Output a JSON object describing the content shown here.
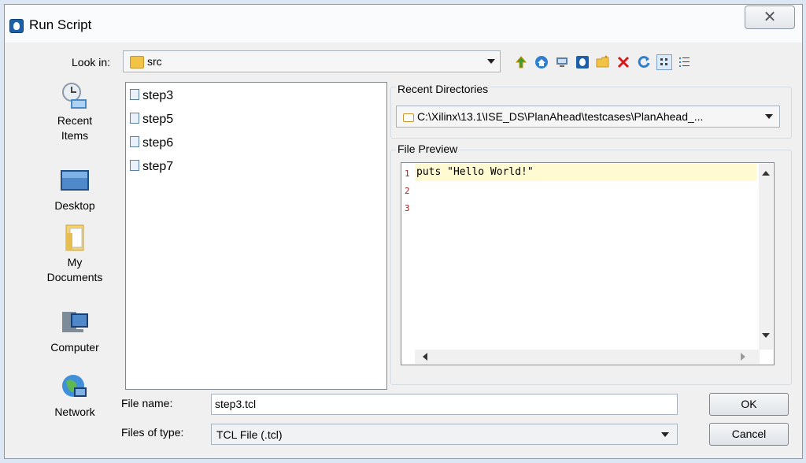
{
  "window": {
    "title": "Run Script",
    "close_glyph": "✕"
  },
  "look_in": {
    "label": "Look in:",
    "value": "src"
  },
  "toolbar": {
    "icons": [
      "up-folder-icon",
      "home-icon",
      "desktop-icon",
      "project-icon",
      "new-folder-icon",
      "delete-icon",
      "refresh-icon",
      "list-view-icon",
      "details-view-icon"
    ]
  },
  "places": [
    {
      "label_line1": "Recent",
      "label_line2": "Items",
      "icon": "recent-items-icon"
    },
    {
      "label_line1": "Desktop",
      "label_line2": "",
      "icon": "desktop-icon"
    },
    {
      "label_line1": "My",
      "label_line2": "Documents",
      "icon": "documents-icon"
    },
    {
      "label_line1": "Computer",
      "label_line2": "",
      "icon": "computer-icon"
    },
    {
      "label_line1": "Network",
      "label_line2": "",
      "icon": "network-icon"
    }
  ],
  "files": [
    "step3",
    "step5",
    "step6",
    "step7"
  ],
  "recent_directories": {
    "label": "Recent Directories",
    "value": "C:\\Xilinx\\13.1\\ISE_DS\\PlanAhead\\testcases\\PlanAhead_..."
  },
  "file_preview": {
    "label": "File Preview",
    "line_numbers": [
      "1",
      "2",
      "3"
    ],
    "code": "puts \"Hello World!\""
  },
  "file_name": {
    "label": "File name:",
    "value": "step3.tcl"
  },
  "files_of_type": {
    "label": "Files of type:",
    "value": "TCL File (.tcl)"
  },
  "buttons": {
    "ok": "OK",
    "cancel": "Cancel"
  },
  "colors": {
    "accent": "#1d5fa8",
    "preview_highlight": "#fffad2",
    "line_number": "#b01b1b"
  }
}
